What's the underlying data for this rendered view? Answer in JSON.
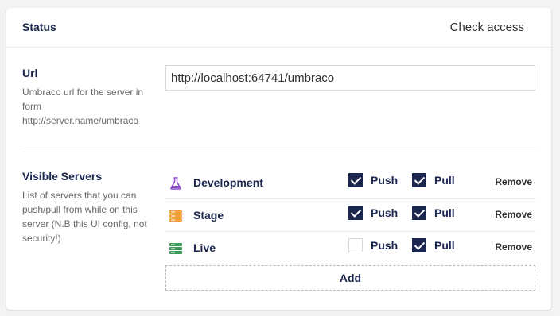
{
  "header": {
    "title": "Status",
    "check_access_label": "Check access"
  },
  "url_section": {
    "label": "Url",
    "description": [
      "Umbraco url for the server in",
      "form",
      "http://server.name/umbraco"
    ],
    "value": "http://localhost:64741/umbraco"
  },
  "servers_section": {
    "label": "Visible Servers",
    "description": [
      "List of servers that you can",
      "push/pull from while on this",
      "server (N.B this UI config, not",
      "security!)"
    ],
    "push_label": "Push",
    "pull_label": "Pull",
    "remove_label": "Remove",
    "add_label": "Add",
    "servers": [
      {
        "name": "Development",
        "icon": "flask-icon",
        "icon_color": "#8a4bd1",
        "push": true,
        "pull": true
      },
      {
        "name": "Stage",
        "icon": "server-icon",
        "icon_color": "#f0a13c",
        "push": true,
        "pull": true
      },
      {
        "name": "Live",
        "icon": "server-icon",
        "icon_color": "#3f9b59",
        "push": false,
        "pull": true
      }
    ]
  },
  "colors": {
    "accent": "#1b264f",
    "text_muted": "#68676b",
    "border": "#d8d7d9"
  }
}
